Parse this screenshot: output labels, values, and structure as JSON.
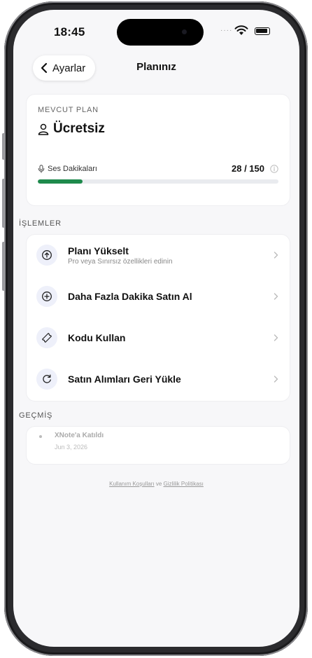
{
  "status_bar": {
    "time": "18:45"
  },
  "nav": {
    "back_label": "Ayarlar",
    "title": "Planınız"
  },
  "plan": {
    "section_label": "MEVCUT PLAN",
    "name": "Ücretsiz",
    "usage_label": "Ses Dakikaları",
    "usage_value": "28 / 150",
    "usage_used": 28,
    "usage_total": 150,
    "accent_color": "#1e8a4c"
  },
  "actions": {
    "section_label": "İŞLEMLER",
    "items": [
      {
        "icon": "arrow-up-circle-icon",
        "title": "Planı Yükselt",
        "subtitle": "Pro veya Sınırsız özellikleri edinin"
      },
      {
        "icon": "plus-circle-icon",
        "title": "Daha Fazla Dakika Satın Al"
      },
      {
        "icon": "ticket-icon",
        "title": "Kodu Kullan"
      },
      {
        "icon": "restore-icon",
        "title": "Satın Alımları Geri Yükle"
      }
    ]
  },
  "history": {
    "section_label": "GEÇMİŞ",
    "items": [
      {
        "title": "XNote'a Katıldı",
        "date": "Jun 3, 2026"
      }
    ]
  },
  "footer": {
    "terms": "Kullanım Koşulları",
    "joiner": "ve",
    "privacy": "Gizlilik Politikası"
  }
}
